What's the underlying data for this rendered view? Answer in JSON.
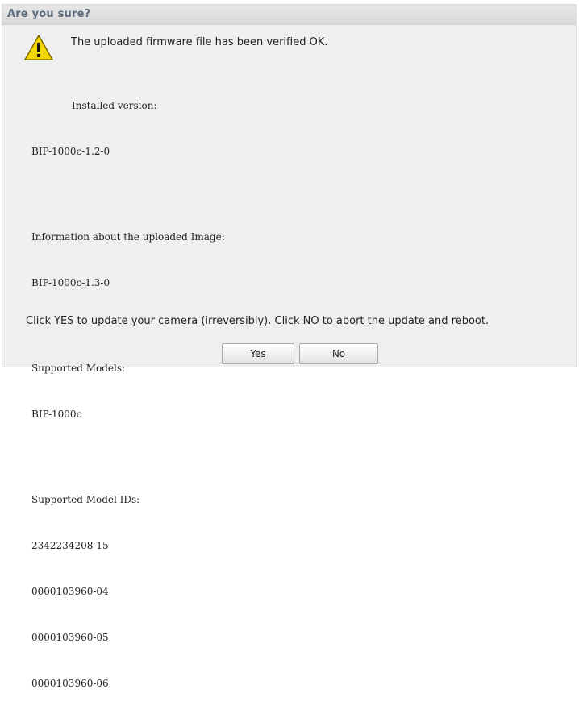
{
  "dialog": {
    "title": "Are you sure?",
    "icon": "warning-icon",
    "verified_message": "The uploaded firmware file has been verified OK.",
    "installed_label": "Installed version:",
    "installed_value": "BIP-1000c-1.2-0",
    "uploaded_label": "Information about the uploaded Image:",
    "uploaded_value": "BIP-1000c-1.3-0",
    "models_label": "Supported Models:",
    "models_value": "BIP-1000c",
    "model_ids_label": "Supported Model IDs:",
    "model_ids": [
      "2342234208-15",
      "0000103960-04",
      "0000103960-05",
      "0000103960-06"
    ],
    "footer_message": "Click YES to update your camera (irreversibly). Click NO to abort the update and reboot.",
    "yes_label": "Yes",
    "no_label": "No"
  },
  "colors": {
    "title_text": "#5b6b7d",
    "dialog_bg": "#efefef",
    "warning_fill": "#f5d800"
  }
}
